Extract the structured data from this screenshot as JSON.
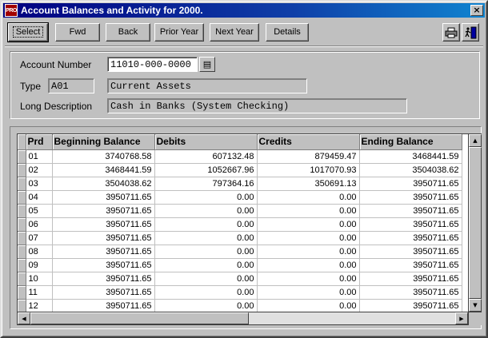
{
  "window": {
    "title": "Account Balances and Activity for 2000.",
    "app_icon_text": "PRO",
    "close_glyph": "×"
  },
  "toolbar": {
    "buttons": [
      {
        "label": "Select"
      },
      {
        "label": "Fwd"
      },
      {
        "label": "Back"
      },
      {
        "label": "Prior Year"
      },
      {
        "label": "Next Year"
      },
      {
        "label": "Details"
      }
    ],
    "icons": [
      "printer-icon",
      "exit-door-icon"
    ]
  },
  "form": {
    "account_number_label": "Account Number",
    "account_number_value": "11010-000-0000",
    "type_label": "Type",
    "type_code": "A01",
    "type_description": "Current Assets",
    "long_description_label": "Long Description",
    "long_description_value": "Cash in Banks (System Checking)"
  },
  "grid": {
    "columns": [
      "Prd",
      "Beginning Balance",
      "Debits",
      "Credits",
      "Ending Balance"
    ],
    "rows": [
      [
        "01",
        "3740768.58",
        "607132.48",
        "879459.47",
        "3468441.59"
      ],
      [
        "02",
        "3468441.59",
        "1052667.96",
        "1017070.93",
        "3504038.62"
      ],
      [
        "03",
        "3504038.62",
        "797364.16",
        "350691.13",
        "3950711.65"
      ],
      [
        "04",
        "3950711.65",
        "0.00",
        "0.00",
        "3950711.65"
      ],
      [
        "05",
        "3950711.65",
        "0.00",
        "0.00",
        "3950711.65"
      ],
      [
        "06",
        "3950711.65",
        "0.00",
        "0.00",
        "3950711.65"
      ],
      [
        "07",
        "3950711.65",
        "0.00",
        "0.00",
        "3950711.65"
      ],
      [
        "08",
        "3950711.65",
        "0.00",
        "0.00",
        "3950711.65"
      ],
      [
        "09",
        "3950711.65",
        "0.00",
        "0.00",
        "3950711.65"
      ],
      [
        "10",
        "3950711.65",
        "0.00",
        "0.00",
        "3950711.65"
      ],
      [
        "11",
        "3950711.65",
        "0.00",
        "0.00",
        "3950711.65"
      ],
      [
        "12",
        "3950711.65",
        "0.00",
        "0.00",
        "3950711.65"
      ]
    ]
  },
  "colors": {
    "titlebar_start": "#000080",
    "titlebar_end": "#1084d0",
    "window_face": "#c0c0c0"
  }
}
